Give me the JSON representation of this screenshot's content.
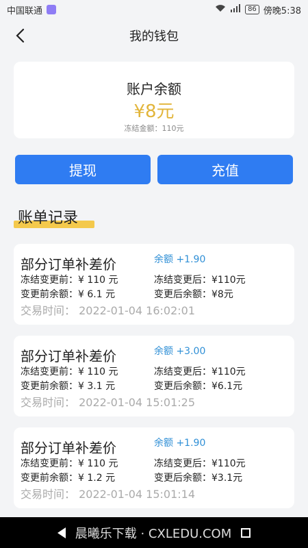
{
  "status_bar": {
    "carrier": "中国联通",
    "battery": "86",
    "time": "傍晚5:38"
  },
  "header": {
    "title": "我的钱包"
  },
  "balance": {
    "title": "账户余额",
    "amount": "¥8元",
    "frozen": "冻结金额：110元"
  },
  "buttons": {
    "withdraw": "提现",
    "recharge": "充值"
  },
  "section_title": "账单记录",
  "records": [
    {
      "title": "部分订单补差价",
      "change": "余额 +1.90",
      "frozen_before": "冻结变更前：¥ 110 元",
      "frozen_after": "冻结变更后：¥110元",
      "balance_before": "变更前余额：¥ 6.1 元",
      "balance_after": "变更后余额：¥8元",
      "time": "交易时间：  2022-01-04 16:02:01"
    },
    {
      "title": "部分订单补差价",
      "change": "余额 +3.00",
      "frozen_before": "冻结变更前：¥ 110 元",
      "frozen_after": "冻结变更后：¥110元",
      "balance_before": "变更前余额：¥ 3.1 元",
      "balance_after": "变更后余额：¥6.1元",
      "time": "交易时间：  2022-01-04 15:01:25"
    },
    {
      "title": "部分订单补差价",
      "change": "余额 +1.90",
      "frozen_before": "冻结变更前：¥ 110 元",
      "frozen_after": "冻结变更后：¥110元",
      "balance_before": "变更前余额：¥ 1.2 元",
      "balance_after": "变更后余额：¥3.1元",
      "time": "交易时间：  2022-01-04 15:01:14"
    }
  ],
  "watermark": "晨曦乐下载 · CXLEDU.COM",
  "icons": {
    "back": "chevron-left-icon",
    "nav_back": "nav-back-icon",
    "nav_recent": "nav-recent-icon"
  }
}
